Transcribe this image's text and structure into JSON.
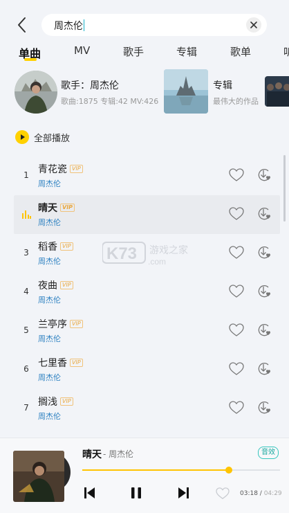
{
  "search": {
    "query": "周杰伦"
  },
  "tabs": [
    "单曲",
    "MV",
    "歌手",
    "专辑",
    "歌单",
    "听"
  ],
  "singer_card": {
    "title": "歌手：周杰伦",
    "meta": "歌曲:1875  专辑:42  MV:426"
  },
  "album_card": {
    "title": "专辑",
    "subtitle": "最伟大的作品"
  },
  "play_all": {
    "label": "全部播放"
  },
  "songs": [
    {
      "num": "1",
      "title": "青花瓷",
      "artist": "周杰伦",
      "vip": "VIP"
    },
    {
      "num": "",
      "title": "晴天",
      "artist": "周杰伦",
      "vip": "VIP"
    },
    {
      "num": "3",
      "title": "稻香",
      "artist": "周杰伦",
      "vip": "VIP"
    },
    {
      "num": "4",
      "title": "夜曲",
      "artist": "周杰伦",
      "vip": "VIP"
    },
    {
      "num": "5",
      "title": "兰亭序",
      "artist": "周杰伦",
      "vip": "VIP"
    },
    {
      "num": "6",
      "title": "七里香",
      "artist": "周杰伦",
      "vip": "VIP"
    },
    {
      "num": "7",
      "title": "搁浅",
      "artist": "周杰伦",
      "vip": "VIP"
    }
  ],
  "player": {
    "title": "晴天",
    "artist": "- 周杰伦",
    "effect": "音效",
    "current": "03:18",
    "total": "04:29",
    "progress": 0.74
  },
  "watermark": {
    "text": "K73",
    "sub": "游戏之家",
    "domain": ".com"
  },
  "colors": {
    "accent": "#ffd100",
    "artist_link": "#2a7fc0",
    "effect": "#1aa89f"
  }
}
